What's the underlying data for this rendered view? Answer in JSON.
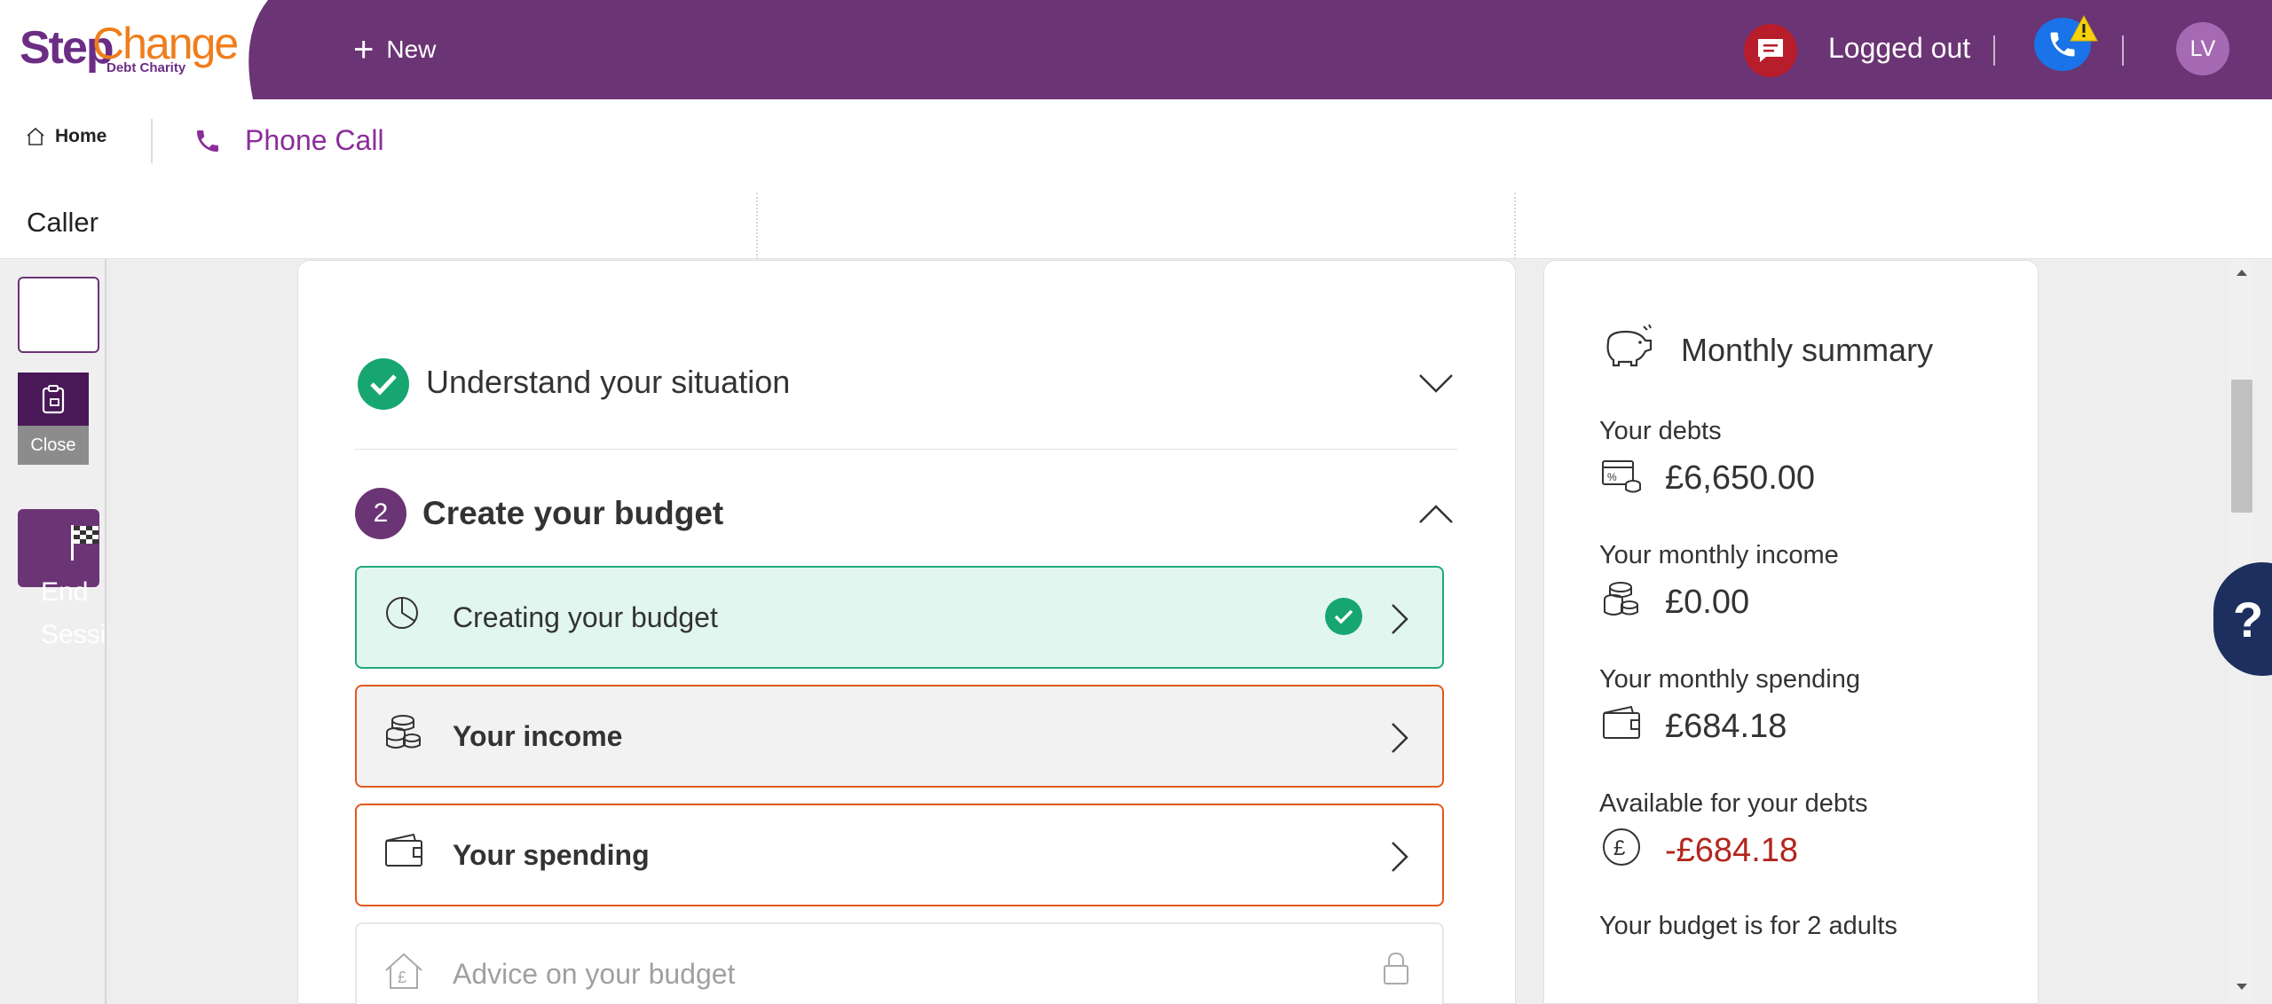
{
  "app": {
    "logo_step": "Step",
    "logo_change": "Change",
    "logo_sub": "Debt Charity",
    "new_label": "New",
    "status_label": "Logged out",
    "avatar_initials": "LV"
  },
  "nav": {
    "home_label": "Home",
    "tab_label": "Phone Call"
  },
  "caller": {
    "label": "Caller"
  },
  "rail": {
    "close_label": "Close",
    "end_label": "End Session"
  },
  "steps": {
    "step1_title": "Understand your situation",
    "step2_number": "2",
    "step2_title": "Create your budget",
    "items": [
      {
        "label": "Creating your budget",
        "state": "complete"
      },
      {
        "label": "Your income",
        "state": "in-progress"
      },
      {
        "label": "Your spending",
        "state": "in-progress"
      },
      {
        "label": "Advice on your budget",
        "state": "locked"
      }
    ]
  },
  "summary": {
    "title": "Monthly summary",
    "debts_label": "Your debts",
    "debts_value": "£6,650.00",
    "income_label": "Your monthly income",
    "income_value": "£0.00",
    "spending_label": "Your monthly spending",
    "spending_value": "£684.18",
    "available_label": "Available for your debts",
    "available_value": "-£684.18",
    "budget_note": "Your budget is for 2 adults"
  },
  "help": {
    "label": "?"
  },
  "colors": {
    "brand_purple": "#6b3474",
    "success_green": "#17a672",
    "alert_orange": "#e05a1e",
    "negative_red": "#b3261e"
  },
  "icons": {
    "new": "plus-icon",
    "chat": "chat-icon",
    "phone_status": "phone-icon",
    "warning": "warning-icon",
    "home": "home-icon",
    "phone_tab": "phone-icon",
    "clipboard": "clipboard-icon",
    "end_session": "flag-icon",
    "piggy": "piggy-bank-icon",
    "debts": "debt-card-icon",
    "income": "coins-icon",
    "spending": "wallet-icon",
    "available": "pound-icon",
    "lock": "lock-icon"
  }
}
